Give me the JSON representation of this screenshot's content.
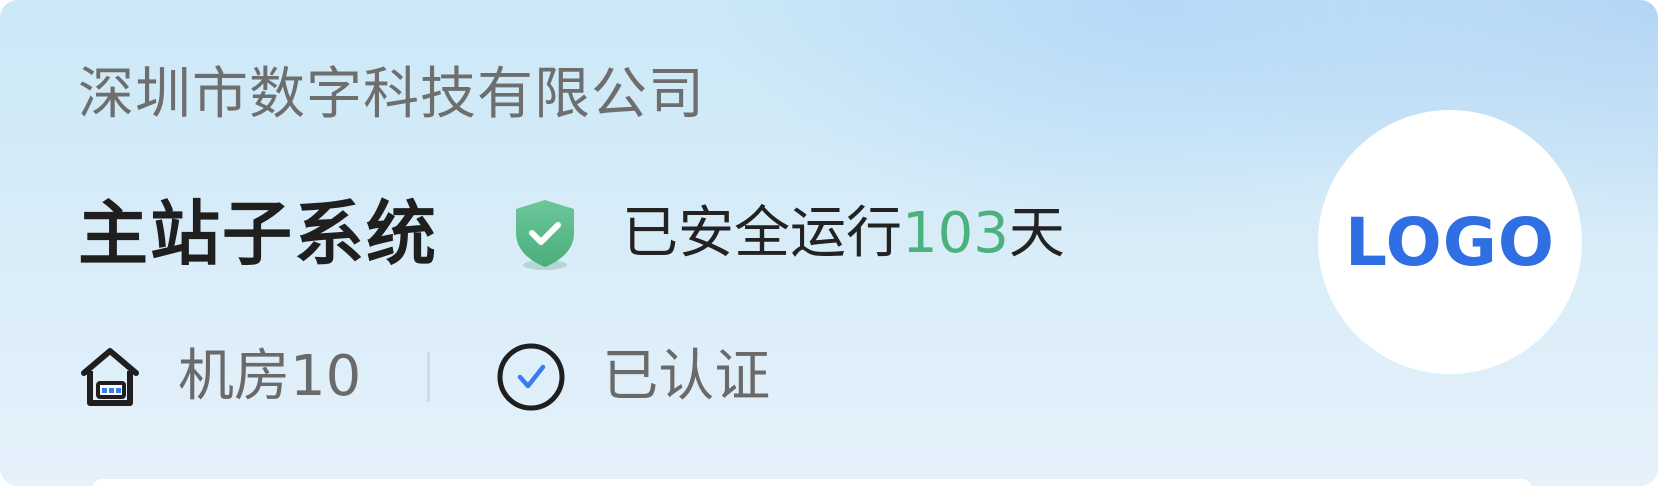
{
  "header": {
    "company_name": "深圳市数字科技有限公司",
    "system_name": "主站子系统",
    "run_status_prefix": "已安全运行",
    "run_days": "103",
    "run_status_suffix": "天",
    "room_label": "机房10",
    "cert_label": "已认证",
    "logo_text": "LOGO"
  },
  "icons": {
    "shield": "shield-check-icon",
    "house": "house-icon",
    "check": "check-circle-icon"
  },
  "colors": {
    "accent_green": "#4bb17e",
    "logo_blue": "#2f6fe3",
    "check_blue": "#3b7bf0"
  }
}
